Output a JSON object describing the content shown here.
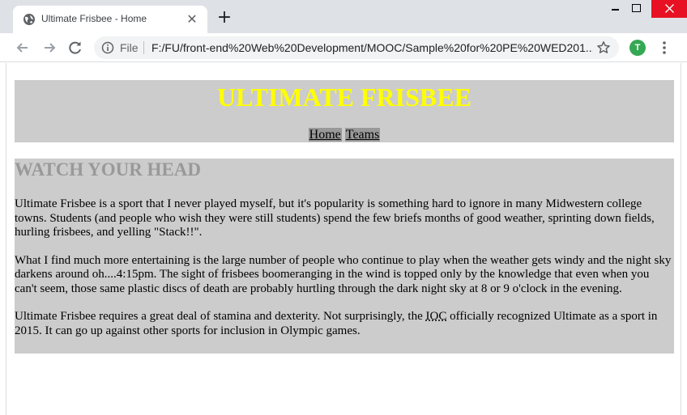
{
  "browser": {
    "tab_title": "Ultimate Frisbee - Home",
    "omnibox_scheme": "File",
    "url": "F:/FU/front-end%20Web%20Development/MOOC/Sample%20for%20PE%20WED201...",
    "profile_initial": "T",
    "profile_color": "#34a853"
  },
  "page": {
    "title": "ULTIMATE FRISBEE",
    "title_color": "#ffff00",
    "nav": [
      "Home",
      "Teams"
    ],
    "section_heading": "WATCH YOUR HEAD",
    "paragraphs": {
      "p1": "Ultimate Frisbee is a sport that I never played myself, but it's popularity is something hard to ignore in many Midwestern college towns. Students (and people who wish they were still students) spend the few briefs months of good weather, sprinting down fields, hurling frisbees, and yelling \"Stack!!\".",
      "p2": "What I find much more entertaining is the large number of people who continue to play when the weather gets windy and the night sky darkens around oh....4:15pm. The sight of frisbees boomeranging in the wind is topped only by the knowledge that even when you can't seem, those same plastic discs of death are probably hurtling through the dark night sky at 8 or 9 o'clock in the evening.",
      "p3_before": "Ultimate Frisbee requires a great deal of stamina and dexterity. Not surprisingly, the ",
      "p3_abbr": "IOC",
      "p3_after": " officially recognized Ultimate as a sport in 2015. It can go up against other sports for inclusion in Olympic games."
    }
  }
}
